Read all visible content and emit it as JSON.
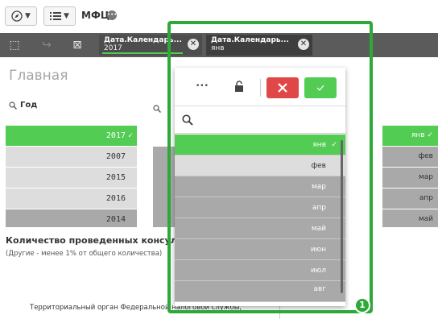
{
  "toolbar": {
    "app_name": "МФЦ",
    "nav_icon": "compass-icon",
    "sheets_icon": "list-icon",
    "dropdown_icon": "chevron-down-icon"
  },
  "selections_bar": {
    "tools": [
      "lasso-select-icon",
      "forward-icon",
      "clear-selections-icon"
    ],
    "chips": [
      {
        "title": "Дата.Календарь...",
        "value": "2017"
      },
      {
        "title": "Дата.Календарь...",
        "value": "янв"
      }
    ]
  },
  "sheet": {
    "title": "Главная"
  },
  "year_listbox": {
    "title": "Год",
    "items": [
      {
        "label": "2017",
        "state": "selected"
      },
      {
        "label": "2007",
        "state": "alternative"
      },
      {
        "label": "2015",
        "state": "alternative"
      },
      {
        "label": "2016",
        "state": "alternative"
      },
      {
        "label": "2014",
        "state": "excluded"
      }
    ]
  },
  "month_listbox_bg": {
    "items": [
      {
        "label": "янв",
        "state": "selected"
      },
      {
        "label": "фев",
        "state": "excluded"
      },
      {
        "label": "мар",
        "state": "excluded"
      },
      {
        "label": "апр",
        "state": "excluded"
      },
      {
        "label": "май",
        "state": "excluded"
      }
    ]
  },
  "kpi": {
    "title": "Количество проведенных консультаций",
    "subtitle": "(Другие - менее 1% от общего количества)"
  },
  "footer": {
    "text": "Территориальный орган Федеральной налоговой службы,"
  },
  "popup": {
    "more_label": "•••",
    "lock_icon": "lock-icon",
    "cancel_icon": "close-icon",
    "confirm_icon": "check-icon",
    "search_icon": "search-icon",
    "items": [
      {
        "label": "янв",
        "state": "selected"
      },
      {
        "label": "фев",
        "state": "alternative"
      },
      {
        "label": "мар",
        "state": "excluded"
      },
      {
        "label": "апр",
        "state": "excluded"
      },
      {
        "label": "май",
        "state": "excluded"
      },
      {
        "label": "июн",
        "state": "excluded"
      },
      {
        "label": "июл",
        "state": "excluded"
      },
      {
        "label": "авг",
        "state": "excluded"
      }
    ]
  },
  "annotation": {
    "badge_number": "1"
  },
  "colors": {
    "selected": "#52cc52",
    "alternative": "#dddddd",
    "excluded": "#a9a9a9",
    "selections_bar": "#5b5b5b",
    "highlight": "#2ea836"
  }
}
